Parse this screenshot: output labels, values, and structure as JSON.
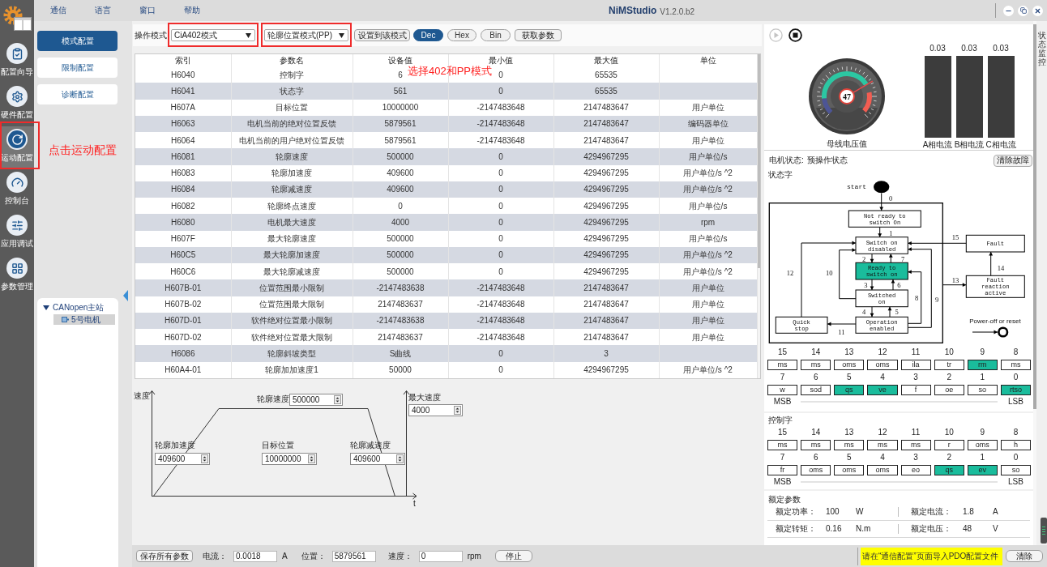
{
  "app": {
    "menu": [
      "通信",
      "语言",
      "窗口",
      "帮助"
    ],
    "title": "NiMStudio",
    "version": "V1.2.0.b2"
  },
  "nav": [
    {
      "label": "配置向导",
      "selected": false,
      "highlighted": false
    },
    {
      "label": "硬件配置",
      "selected": false,
      "highlighted": false
    },
    {
      "label": "运动配置",
      "selected": true,
      "highlighted": true
    },
    {
      "label": "控制台",
      "selected": false,
      "highlighted": false
    },
    {
      "label": "应用调试",
      "selected": false,
      "highlighted": false
    },
    {
      "label": "参数管理",
      "selected": false,
      "highlighted": false
    }
  ],
  "nav_note": "点击运动配置",
  "sub_nav": [
    {
      "label": "模式配置",
      "selected": true
    },
    {
      "label": "限制配置",
      "selected": false
    },
    {
      "label": "诊断配置",
      "selected": false
    }
  ],
  "device_tree": {
    "label": "CANopen主站",
    "expanded": true,
    "children": [
      {
        "label": "5号电机",
        "selected": true
      }
    ]
  },
  "toolbar": {
    "mode_label": "操作模式",
    "dropdowns": [
      {
        "value": "CiA402模式",
        "highlighted": true
      },
      {
        "value": "轮廓位置模式(PP)",
        "highlighted": true
      }
    ],
    "set_button": "设置到该模式",
    "formats": [
      {
        "label": "Dec",
        "selected": true
      },
      {
        "label": "Hex",
        "selected": false
      },
      {
        "label": "Bin",
        "selected": false
      }
    ],
    "fetch_button": "获取参数"
  },
  "table_note": "选择402和PP模式",
  "table": {
    "columns": [
      "索引",
      "参数名",
      "设备值",
      "最小值",
      "最大值",
      "单位"
    ],
    "rows": [
      {
        "index": "H6040",
        "name": "控制字",
        "device_value": "6",
        "min": "0",
        "max": "65535"
      },
      {
        "index": "H6041",
        "name": "状态字",
        "device_value": "561",
        "min": "0",
        "max": "65535"
      },
      {
        "index": "H607A",
        "name": "目标位置",
        "device_value": "10000000",
        "min": "-2147483648",
        "max": "2147483647",
        "unit": "用户单位"
      },
      {
        "index": "H6063",
        "name": "电机当前的绝对位置反馈",
        "device_value": "5879561",
        "min": "-2147483648",
        "max": "2147483647",
        "unit": "编码器单位"
      },
      {
        "index": "H6064",
        "name": "电机当前的用户绝对位置反馈",
        "device_value": "5879561",
        "min": "-2147483648",
        "max": "2147483647",
        "unit": "用户单位"
      },
      {
        "index": "H6081",
        "name": "轮廓速度",
        "device_value": "500000",
        "min": "0",
        "max": "4294967295",
        "unit": "用户单位/s"
      },
      {
        "index": "H6083",
        "name": "轮廓加速度",
        "device_value": "409600",
        "min": "0",
        "max": "4294967295",
        "unit": "用户单位/s ^2"
      },
      {
        "index": "H6084",
        "name": "轮廓减速度",
        "device_value": "409600",
        "min": "0",
        "max": "4294967295",
        "unit": "用户单位/s ^2"
      },
      {
        "index": "H6082",
        "name": "轮廓终点速度",
        "device_value": "0",
        "min": "0",
        "max": "4294967295",
        "unit": "用户单位/s"
      },
      {
        "index": "H6080",
        "name": "电机最大速度",
        "device_value": "4000",
        "min": "0",
        "max": "4294967295",
        "unit": "rpm"
      },
      {
        "index": "H607F",
        "name": "最大轮廓速度",
        "device_value": "500000",
        "min": "0",
        "max": "4294967295",
        "unit": "用户单位/s"
      },
      {
        "index": "H60C5",
        "name": "最大轮廓加速度",
        "device_value": "500000",
        "min": "0",
        "max": "4294967295",
        "unit": "用户单位/s ^2"
      },
      {
        "index": "H60C6",
        "name": "最大轮廓减速度",
        "device_value": "500000",
        "min": "0",
        "max": "4294967295",
        "unit": "用户单位/s ^2"
      },
      {
        "index": "H607B-01",
        "name": "位置范围最小限制",
        "device_value": "-2147483638",
        "min": "-2147483648",
        "max": "2147483647",
        "unit": "用户单位"
      },
      {
        "index": "H607B-02",
        "name": "位置范围最大限制",
        "device_value": "2147483637",
        "min": "-2147483648",
        "max": "2147483647",
        "unit": "用户单位"
      },
      {
        "index": "H607D-01",
        "name": "软件绝对位置最小限制",
        "device_value": "-2147483638",
        "min": "-2147483648",
        "max": "2147483647",
        "unit": "用户单位"
      },
      {
        "index": "H607D-02",
        "name": "软件绝对位置最大限制",
        "device_value": "2147483637",
        "min": "-2147483648",
        "max": "2147483647",
        "unit": "用户单位"
      },
      {
        "index": "H6086",
        "name": "轮廓斜坡类型",
        "device_value": "S曲线",
        "min": "0",
        "max": "3"
      },
      {
        "index": "H60A4-01",
        "name": "轮廓加加速度1",
        "device_value": "50000",
        "min": "0",
        "max": "4294967295",
        "unit": "用户单位/s ^2"
      }
    ]
  },
  "profile": {
    "y_label": "速度",
    "x_label": "t",
    "fields": [
      {
        "label": "轮廓速度",
        "value": "500000"
      },
      {
        "label": "轮廓加速度",
        "value": "409600"
      },
      {
        "label": "目标位置",
        "value": "10000000"
      },
      {
        "label": "轮廓减速度",
        "value": "409600"
      },
      {
        "label": "最大速度",
        "value": "4000"
      }
    ]
  },
  "monitor": {
    "controls": [
      {
        "kind": "play",
        "disabled": true
      },
      {
        "kind": "stop",
        "disabled": false
      }
    ],
    "gauge": {
      "value": "47",
      "label": "母线电压值",
      "level": 0.72
    },
    "phase_currents": [
      {
        "value": "0.03",
        "label": "A相电流"
      },
      {
        "value": "0.03",
        "label": "B相电流"
      },
      {
        "value": "0.03",
        "label": "C相电流"
      }
    ],
    "motor_state": {
      "label": "电机状态:",
      "value": "预操作状态"
    },
    "clear_fault_button": "清除故障",
    "status_word": {
      "title": "状态字",
      "diagram": {
        "start": "start",
        "states": [
          {
            "lines": [
              "Not ready to",
              "switch On"
            ],
            "active": false
          },
          {
            "lines": [
              "Switch on",
              "disabled"
            ],
            "active": false
          },
          {
            "lines": [
              "Fault"
            ],
            "active": false
          },
          {
            "lines": [
              "Ready to",
              "switch on"
            ],
            "active": true
          },
          {
            "lines": [
              "Fault",
              "reaction",
              "active"
            ],
            "active": false
          },
          {
            "lines": [
              "Switched",
              "on"
            ],
            "active": false
          },
          {
            "lines": [
              "Quick",
              "stop"
            ],
            "active": false
          },
          {
            "lines": [
              "Operation",
              "enabled"
            ],
            "active": false
          }
        ],
        "transitions": [
          "0",
          "1",
          "2",
          "3",
          "4",
          "5",
          "6",
          "7",
          "8",
          "9",
          "10",
          "11",
          "12",
          "13",
          "14",
          "15"
        ],
        "power_off": "Power-off or reset"
      },
      "bits": [
        {
          "bit": "15",
          "name": "ms",
          "on": false
        },
        {
          "bit": "14",
          "name": "ms",
          "on": false
        },
        {
          "bit": "13",
          "name": "oms",
          "on": false
        },
        {
          "bit": "12",
          "name": "oms",
          "on": false
        },
        {
          "bit": "11",
          "name": "ila",
          "on": false
        },
        {
          "bit": "10",
          "name": "tr",
          "on": false
        },
        {
          "bit": "9",
          "name": "rm",
          "on": true
        },
        {
          "bit": "8",
          "name": "ms",
          "on": false
        },
        {
          "bit": "7",
          "name": "w",
          "on": false
        },
        {
          "bit": "6",
          "name": "sod",
          "on": false
        },
        {
          "bit": "5",
          "name": "qs",
          "on": true
        },
        {
          "bit": "4",
          "name": "ve",
          "on": true
        },
        {
          "bit": "3",
          "name": "f",
          "on": false
        },
        {
          "bit": "2",
          "name": "oe",
          "on": false
        },
        {
          "bit": "1",
          "name": "so",
          "on": false
        },
        {
          "bit": "0",
          "name": "rtso",
          "on": true
        }
      ],
      "msb": "MSB",
      "lsb": "LSB"
    },
    "control_word": {
      "title": "控制字",
      "bits": [
        {
          "bit": "15",
          "name": "ms",
          "on": false
        },
        {
          "bit": "14",
          "name": "ms",
          "on": false
        },
        {
          "bit": "13",
          "name": "ms",
          "on": false
        },
        {
          "bit": "12",
          "name": "ms",
          "on": false
        },
        {
          "bit": "11",
          "name": "ms",
          "on": false
        },
        {
          "bit": "10",
          "name": "r",
          "on": false
        },
        {
          "bit": "9",
          "name": "oms",
          "on": false
        },
        {
          "bit": "8",
          "name": "h",
          "on": false
        },
        {
          "bit": "7",
          "name": "fr",
          "on": false
        },
        {
          "bit": "6",
          "name": "oms",
          "on": false
        },
        {
          "bit": "5",
          "name": "oms",
          "on": false
        },
        {
          "bit": "4",
          "name": "oms",
          "on": false
        },
        {
          "bit": "3",
          "name": "eo",
          "on": false
        },
        {
          "bit": "2",
          "name": "qs",
          "on": true
        },
        {
          "bit": "1",
          "name": "ev",
          "on": true
        },
        {
          "bit": "0",
          "name": "so",
          "on": false
        }
      ],
      "msb": "MSB",
      "lsb": "LSB"
    },
    "rated": {
      "title": "额定参数",
      "items": [
        {
          "label": "额定功率：",
          "value": "100",
          "unit": "W"
        },
        {
          "label": "额定电流：",
          "value": "1.8",
          "unit": "A"
        },
        {
          "label": "额定转矩：",
          "value": "0.16",
          "unit": "N.m"
        },
        {
          "label": "额定电压：",
          "value": "48",
          "unit": "V"
        }
      ]
    }
  },
  "side_tab": "状态监控",
  "status_bar": {
    "save_button": "保存所有参数",
    "readouts": [
      {
        "label": "电流：",
        "value": "0.0018",
        "unit": "A"
      },
      {
        "label": "位置：",
        "value": "5879561"
      },
      {
        "label": "速度：",
        "value": "0",
        "unit": "rpm"
      }
    ],
    "stop_button": "停止",
    "notice": "请在“通信配置”页面导入PDO配置文件",
    "clear_button": "清除"
  }
}
